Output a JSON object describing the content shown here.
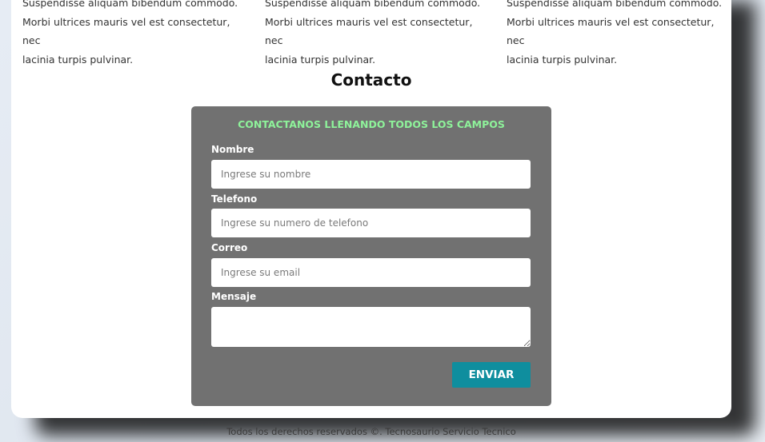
{
  "columns": [
    {
      "line1": "Suspendisse aliquam bibendum commodo.",
      "line2": "Morbi ultrices mauris vel est consectetur, nec",
      "line3": "lacinia turpis pulvinar."
    },
    {
      "line1": "Suspendisse aliquam bibendum commodo.",
      "line2": "Morbi ultrices mauris vel est consectetur, nec",
      "line3": "lacinia turpis pulvinar."
    },
    {
      "line1": "Suspendisse aliquam bibendum commodo.",
      "line2": "Morbi ultrices mauris vel est consectetur, nec",
      "line3": "lacinia turpis pulvinar."
    }
  ],
  "contact": {
    "title": "Contacto",
    "form_heading": "CONTACTANOS LLENANDO TODOS LOS CAMPOS",
    "fields": {
      "name": {
        "label": "Nombre",
        "placeholder": "Ingrese su nombre",
        "value": ""
      },
      "phone": {
        "label": "Telefono",
        "placeholder": "Ingrese su numero de telefono",
        "value": ""
      },
      "email": {
        "label": "Correo",
        "placeholder": "Ingrese su email",
        "value": ""
      },
      "message": {
        "label": "Mensaje",
        "placeholder": "",
        "value": ""
      }
    },
    "submit_label": "ENVIAR"
  },
  "footer": {
    "text": "Todos los derechos reservados ©. Tecnosaurio Servicio Tecnico"
  },
  "colors": {
    "panel_bg": "#717171",
    "heading_accent": "#8ef29a",
    "button_bg": "#0f8e9e",
    "card_bg": "#ffffff"
  }
}
